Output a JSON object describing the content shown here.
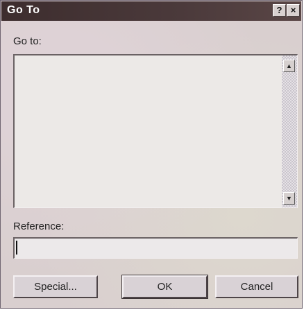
{
  "window": {
    "title": "Go To",
    "help_button": "?",
    "close_button": "×"
  },
  "goto": {
    "label": "Go to:",
    "items": []
  },
  "reference": {
    "label": "Reference:",
    "value": "",
    "placeholder": ""
  },
  "scrollbar": {
    "up_arrow": "▲",
    "down_arrow": "▼"
  },
  "buttons": {
    "special": "Special...",
    "ok": "OK",
    "cancel": "Cancel"
  },
  "icons": {
    "help": "question-mark-icon",
    "close": "close-icon",
    "up": "arrow-up-icon",
    "down": "arrow-down-icon"
  }
}
